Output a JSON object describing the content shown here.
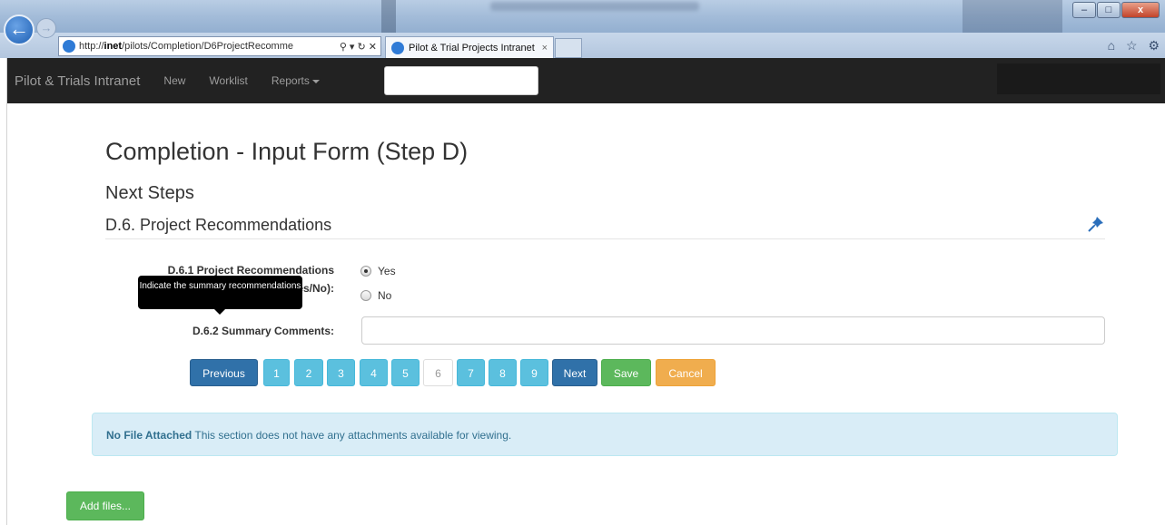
{
  "browser": {
    "url_prefix": "http://",
    "url_host": "inet",
    "url_path": "/pilots/Completion/D6ProjectRecomme",
    "address_controls": "⚲ ▾ ↻ ✕",
    "tab_title": "Pilot & Trial Projects Intranet",
    "tab_close": "×",
    "window_buttons": [
      "–",
      "□",
      "x"
    ],
    "toolbar_icons": "⌂ ☆ ⚙"
  },
  "navbar": {
    "brand": "Pilot & Trials Intranet",
    "links": [
      "New",
      "Worklist",
      "Reports"
    ]
  },
  "page": {
    "title": "Completion - Input Form (Step D)",
    "subheading": "Next Steps",
    "section": "D.6. Project Recommendations"
  },
  "form": {
    "q1_label_line1": "D.6.1 Project Recommendations",
    "q1_label_line2": "(Yes/No):",
    "q1_options": [
      "Yes",
      "No"
    ],
    "q1_selected": "Yes",
    "tooltip": "Indicate the summary recommendations",
    "q2_label": "D.6.2 Summary Comments:",
    "q2_value": ""
  },
  "pager": {
    "previous": "Previous",
    "pages": [
      "1",
      "2",
      "3",
      "4",
      "5",
      "6",
      "7",
      "8",
      "9"
    ],
    "current_page": "6",
    "next": "Next",
    "save": "Save",
    "cancel": "Cancel"
  },
  "attachments": {
    "status": "No File Attached",
    "message": "This section does not have any attachments available for viewing."
  },
  "add_files_button": "Add files...",
  "colors": {
    "navbar_bg": "#222222",
    "primary": "#3071a9",
    "info": "#5bc0de",
    "success": "#5cb85c",
    "warning": "#f0ad4e",
    "alert_bg": "#d9edf7"
  }
}
